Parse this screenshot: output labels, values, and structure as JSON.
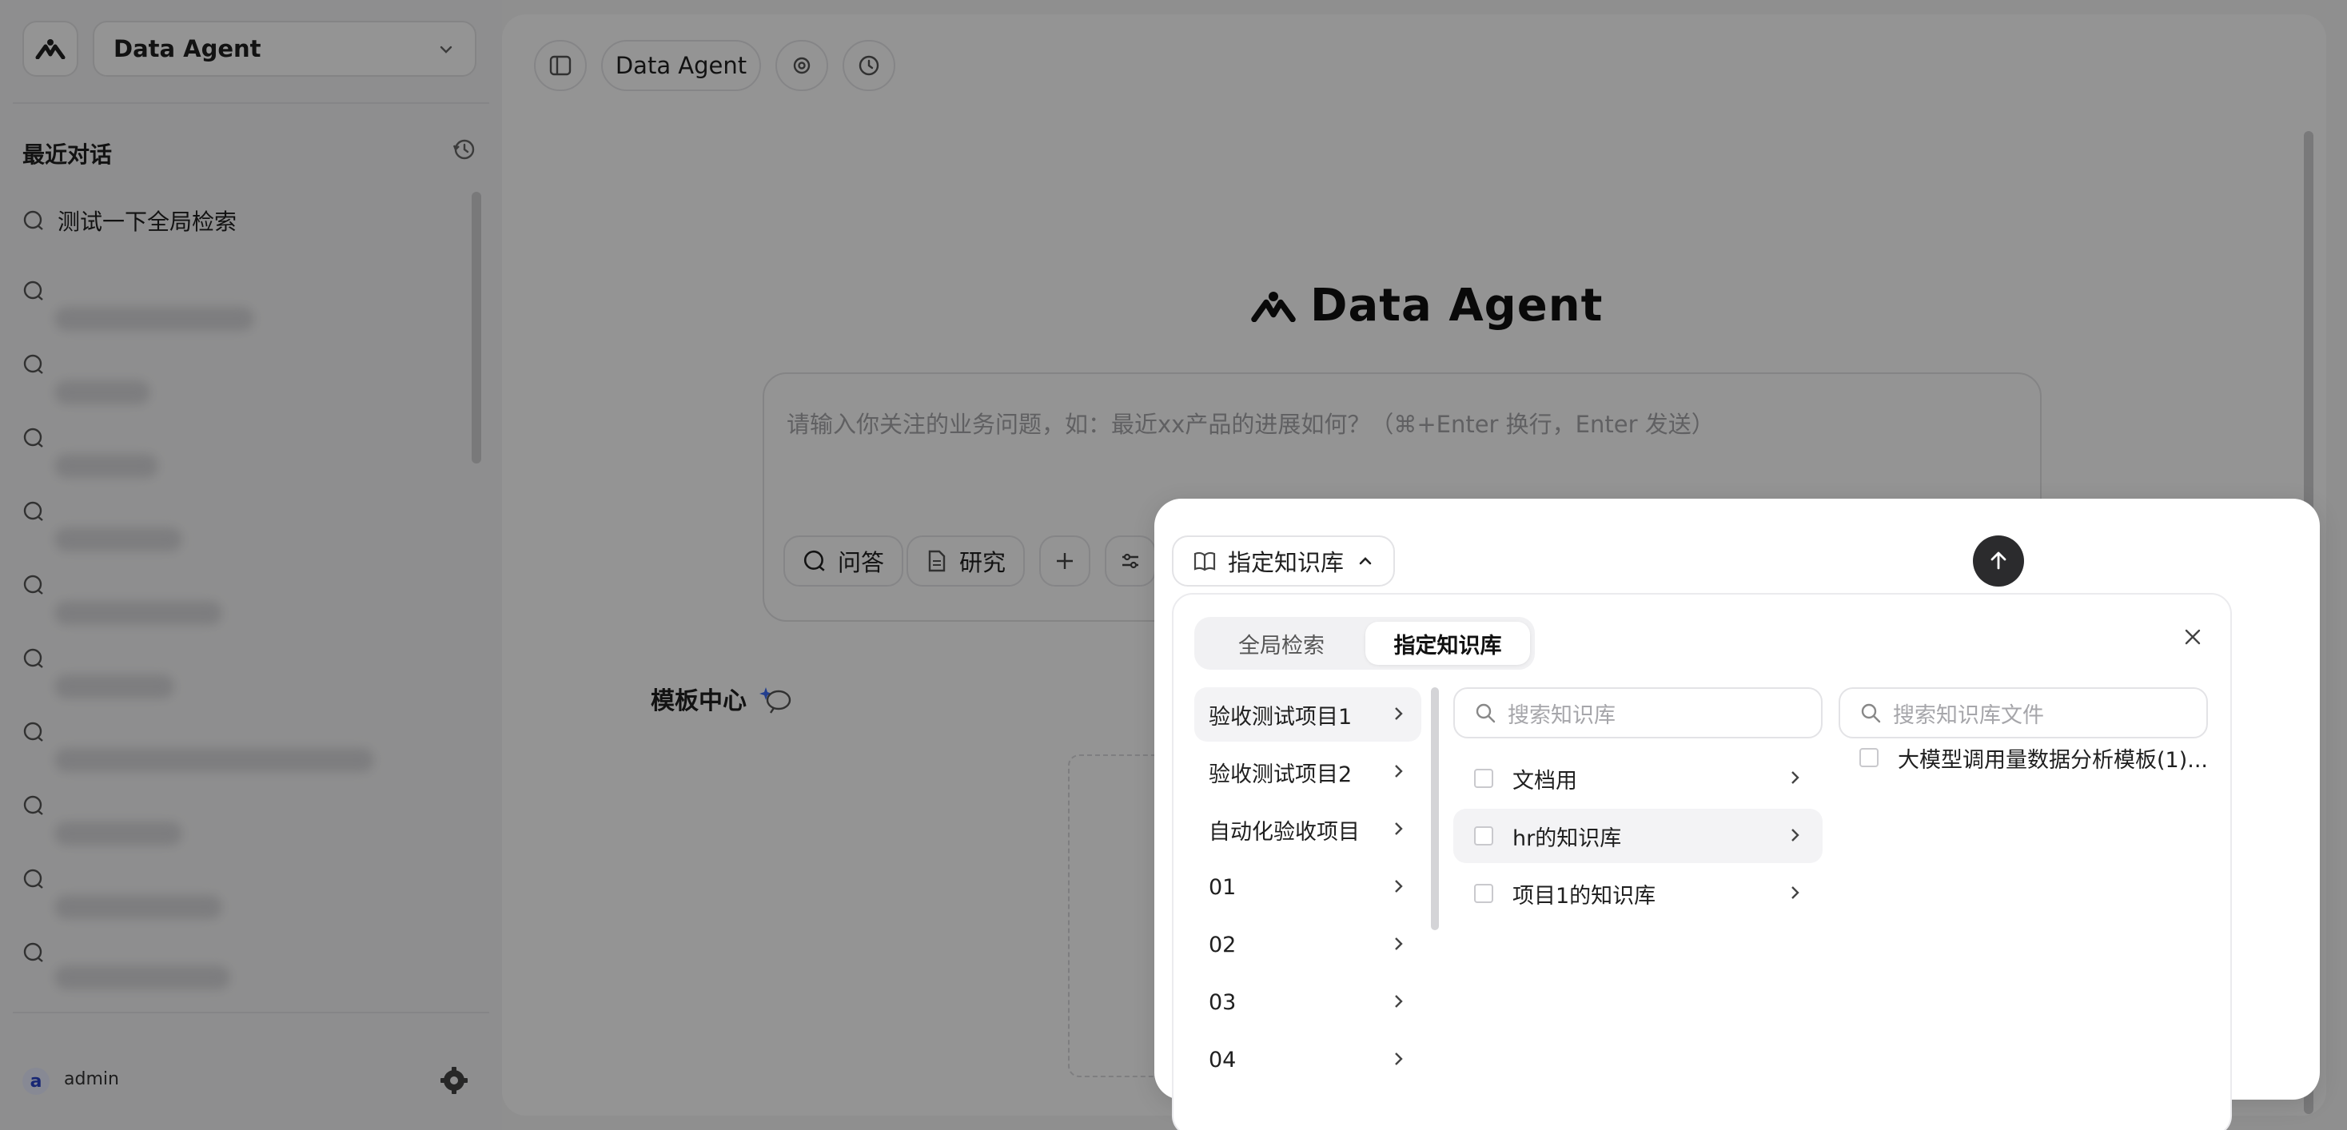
{
  "sidebar": {
    "agent_name": "Data Agent",
    "recent_title": "最近对话",
    "first_conversation": "测试一下全局检索",
    "user_initial": "a",
    "user_name": "admin"
  },
  "toolbar": {
    "agent_label": "Data Agent"
  },
  "main": {
    "brand": "Data Agent",
    "input_placeholder": "请输入你关注的业务问题，如：最近xx产品的进展如何？（⌘+Enter 换行，Enter 发送）",
    "mode_qa": "问答",
    "mode_research": "研究",
    "template_center": "模板中心"
  },
  "popup": {
    "kb_chip_label": "指定知识库",
    "tabs": [
      "全局检索",
      "指定知识库"
    ],
    "active_tab": "指定知识库",
    "projects": [
      "验收测试项目1",
      "验收测试项目2",
      "自动化验收项目",
      "01",
      "02",
      "03",
      "04"
    ],
    "kb_search_placeholder": "搜索知识库",
    "file_search_placeholder": "搜索知识库文件",
    "knowledge_bases": [
      "文档用",
      "hr的知识库",
      "项目1的知识库"
    ],
    "files": [
      "大模型调用量数据分析模板(1)..."
    ]
  }
}
